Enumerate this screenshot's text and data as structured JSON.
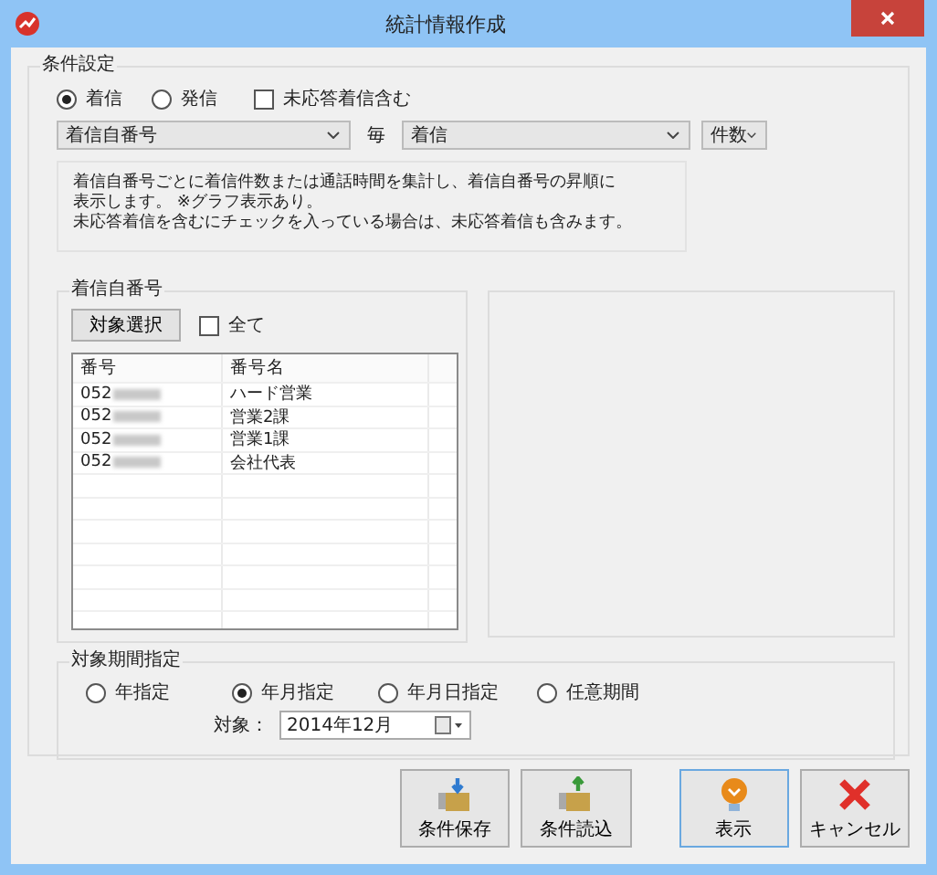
{
  "window": {
    "title": "統計情報作成"
  },
  "conditions": {
    "title": "条件設定",
    "direction": [
      {
        "label": "着信",
        "selected": true
      },
      {
        "label": "発信",
        "selected": false
      }
    ],
    "include_unanswered": {
      "label": "未応答着信含む",
      "checked": false
    },
    "group_by": "着信自番号",
    "per_label": "毎",
    "target": "着信",
    "measure": "件数",
    "description": [
      "着信自番号ごとに着信件数または通話時間を集計し、着信自番号の昇順に",
      "表示します。 ※グラフ表示あり。",
      "未応答着信を含むにチェックを入っている場合は、未応答着信も含みます。"
    ]
  },
  "numbers": {
    "title": "着信自番号",
    "select_button": "対象選択",
    "all": {
      "label": "全て",
      "checked": false
    },
    "columns": [
      "番号",
      "番号名"
    ],
    "rows": [
      {
        "number": "052",
        "name": "ハード営業"
      },
      {
        "number": "052",
        "name": "営業2課"
      },
      {
        "number": "052",
        "name": "営業1課"
      },
      {
        "number": "052",
        "name": "会社代表"
      }
    ]
  },
  "period": {
    "title": "対象期間指定",
    "options": [
      {
        "label": "年指定",
        "selected": false
      },
      {
        "label": "年月指定",
        "selected": true
      },
      {
        "label": "年月日指定",
        "selected": false
      },
      {
        "label": "任意期間",
        "selected": false
      }
    ],
    "target_label": "対象：",
    "target_value": "2014年12月"
  },
  "buttons": [
    {
      "label": "条件保存",
      "kind": "save",
      "default": false
    },
    {
      "label": "条件読込",
      "kind": "load",
      "default": false
    },
    {
      "label": "表示",
      "kind": "show",
      "default": true
    },
    {
      "label": "キャンセル",
      "kind": "cancel",
      "default": false
    }
  ]
}
